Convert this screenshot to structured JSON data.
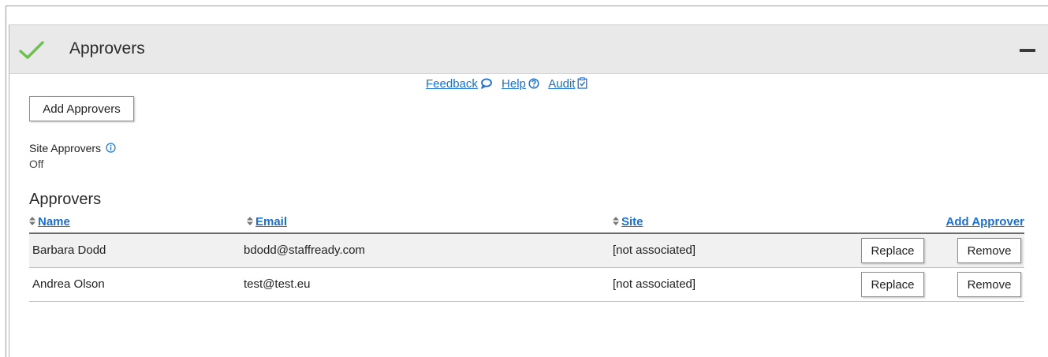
{
  "panel": {
    "title": "Approvers",
    "status_icon": "check-icon",
    "collapse_icon": "minus-icon",
    "accent_color": "#6cc24a"
  },
  "top_links": [
    {
      "label": "Feedback",
      "icon": "speech-bubble-icon"
    },
    {
      "label": "Help",
      "icon": "question-circle-icon"
    },
    {
      "label": "Audit",
      "icon": "clipboard-check-icon"
    }
  ],
  "add_approvers_button": "Add Approvers",
  "site_approvers": {
    "label": "Site Approvers",
    "info_icon": "info-icon",
    "value": "Off"
  },
  "approvers_table": {
    "heading": "Approvers",
    "columns": [
      "Name",
      "Email",
      "Site"
    ],
    "add_link": "Add Approver",
    "rows": [
      {
        "name": "Barbara Dodd",
        "email": "bdodd@staffready.com",
        "site": "[not associated]",
        "replace": "Replace",
        "remove": "Remove"
      },
      {
        "name": "Andrea Olson",
        "email": "test@test.eu",
        "site": "[not associated]",
        "replace": "Replace",
        "remove": "Remove"
      }
    ]
  },
  "colors": {
    "link": "#1a6fd1",
    "header_bg": "#e9e9e9",
    "row_alt_bg": "#f1f1f1"
  }
}
